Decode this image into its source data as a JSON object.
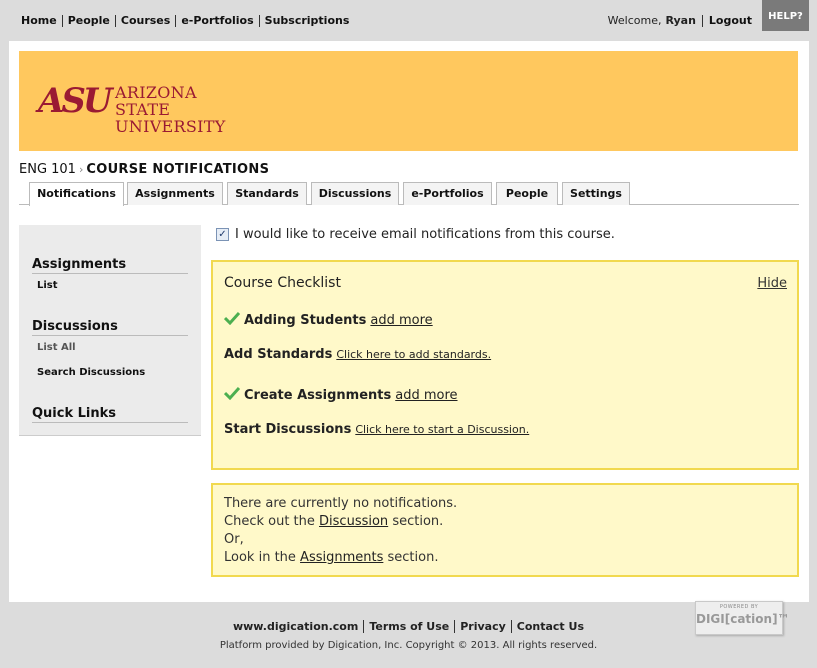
{
  "top_nav": {
    "items": [
      "Home",
      "People",
      "Courses",
      "e-Portfolios",
      "Subscriptions"
    ],
    "welcome_label": "Welcome,",
    "user_name": "Ryan",
    "logout_label": "Logout",
    "help_label": "HELP?"
  },
  "banner": {
    "logo_mark": "ASU",
    "logo_line1": "ARIZONA STATE",
    "logo_line2": "UNIVERSITY",
    "color": "#ffc85e",
    "logo_color": "#9a1a33"
  },
  "breadcrumb": {
    "course": "ENG 101",
    "separator": "›",
    "current": "COURSE NOTIFICATIONS"
  },
  "tabs": [
    {
      "label": "Notifications",
      "active": true
    },
    {
      "label": "Assignments",
      "active": false
    },
    {
      "label": "Standards",
      "active": false
    },
    {
      "label": "Discussions",
      "active": false
    },
    {
      "label": "e-Portfolios",
      "active": false
    },
    {
      "label": "People",
      "active": false
    },
    {
      "label": "Settings",
      "active": false
    }
  ],
  "sidebar": {
    "sections": [
      {
        "heading": "Assignments",
        "items": [
          "List"
        ]
      },
      {
        "heading": "Discussions",
        "items": [
          "List All",
          "Search Discussions"
        ]
      },
      {
        "heading": "Quick Links",
        "items": []
      }
    ]
  },
  "email_optin": {
    "checked": true,
    "label": "I would like to receive email notifications from this course."
  },
  "checklist": {
    "title": "Course Checklist",
    "hide_label": "Hide",
    "items": [
      {
        "done": true,
        "label": "Adding Students",
        "link": "add more"
      },
      {
        "done": false,
        "label": "Add Standards",
        "link": "Click here to add standards."
      },
      {
        "done": true,
        "label": "Create Assignments",
        "link": "add more"
      },
      {
        "done": false,
        "label": "Start Discussions",
        "link": "Click here to start a Discussion."
      }
    ]
  },
  "notifications": {
    "line1": "There are currently no notifications.",
    "line2_pre": "Check out the",
    "line2_link": "Discussion",
    "line2_post": "section.",
    "line3": "Or,",
    "line4_pre": "Look in the",
    "line4_link": "Assignments",
    "line4_post": "section."
  },
  "footer": {
    "links": [
      "www.digication.com",
      "Terms of Use",
      "Privacy",
      "Contact Us"
    ],
    "copyright": "Platform provided by Digication, Inc. Copyright © 2013. All rights reserved.",
    "badge_top": "POWERED BY",
    "badge_main": "DIGI[cation]™"
  }
}
